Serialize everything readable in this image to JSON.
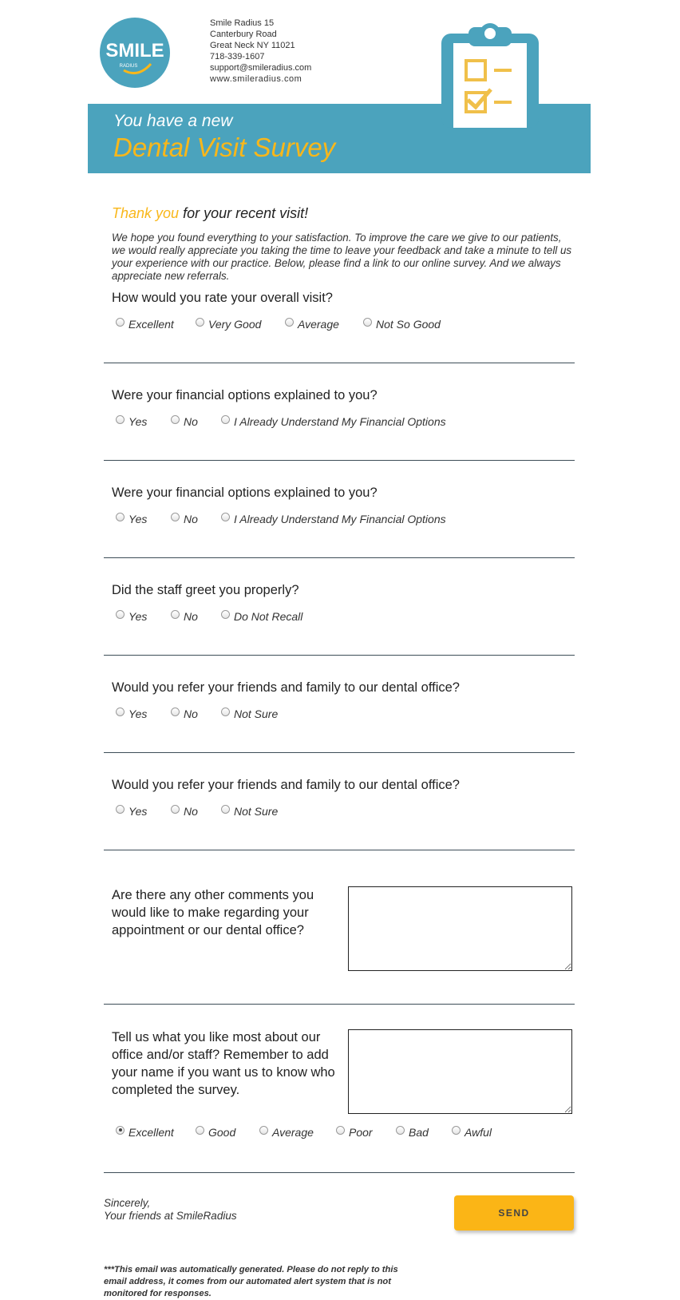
{
  "header": {
    "logo_text": "SMILE",
    "logo_subtext": "RADIUS",
    "address": [
      "Smile Radius 15",
      "Canterbury Road",
      "Great Neck NY 11021",
      "718-339-1607",
      "support@smileradius.com",
      "www.smileradius.com"
    ],
    "icon": "clipboard-checklist-icon"
  },
  "banner": {
    "line1": "You have a new",
    "line2": "Dental Visit Survey"
  },
  "intro": {
    "thank_accent": "Thank you",
    "thank_rest": " for your recent visit!",
    "paragraph": "We hope you found everything to your satisfaction. To improve the care we give to our patients, we would really appreciate you taking the time to leave your feedback and take a minute to tell us your experience with our practice. Below, please find a link to our online survey. And we always appreciate new referrals."
  },
  "questions": [
    {
      "text": "How would you rate your overall visit?",
      "options": [
        "Excellent",
        "Very Good",
        "Average",
        "Not So Good"
      ]
    },
    {
      "text": "Were your financial options explained to you?",
      "options": [
        "Yes",
        "No",
        "I Already Understand My Financial Options"
      ]
    },
    {
      "text": "Were your financial options explained to you?",
      "options": [
        "Yes",
        "No",
        "I Already Understand My Financial Options"
      ]
    },
    {
      "text": "Did the staff greet you properly?",
      "options": [
        "Yes",
        "No",
        "Do Not Recall"
      ]
    },
    {
      "text": "Would you refer your friends and family to our dental office?",
      "options": [
        "Yes",
        "No",
        "Not Sure"
      ]
    },
    {
      "text": "Would you refer your friends and family to our dental office?",
      "options": [
        "Yes",
        "No",
        "Not Sure"
      ]
    }
  ],
  "comments": {
    "question": "Are there any other comments you would like to make regarding your appointment or our dental office?",
    "value": ""
  },
  "likes": {
    "question": "Tell us what you like most about our office and/or staff? Remember to add your name if you want us to know who completed the survey.",
    "value": "",
    "rating_options": [
      "Excellent",
      "Good",
      "Average",
      "Poor",
      "Bad",
      "Awful"
    ],
    "rating_selected": "Excellent"
  },
  "closing": {
    "line1": "Sincerely,",
    "line2": "Your friends at SmileRadius"
  },
  "send_label": "SEND",
  "footer_note": "***This email was automatically generated. Please do not reply to this email address, it comes from our automated alert system that is not monitored for responses.",
  "colors": {
    "brand": "#4ba3bd",
    "accent": "#f9b71a",
    "button": "#fbb516"
  }
}
